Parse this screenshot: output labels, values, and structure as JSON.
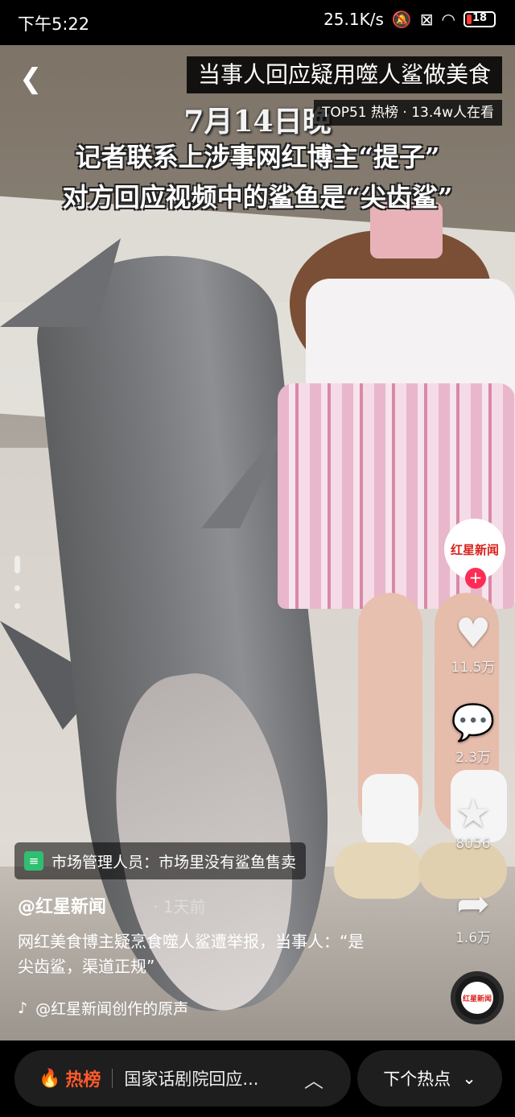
{
  "status_bar": {
    "time": "下午5:22",
    "net_speed": "25.1K/s",
    "battery": "18"
  },
  "header": {
    "back_icon": "chevron-left-icon",
    "title": "当事人回应疑用噬人鲨做美食",
    "hot_rank": "TOP51 热榜",
    "viewers": "13.4w人在看"
  },
  "video_captions": {
    "date": "7月14日晚",
    "line1": "记者联系上涉事网红博主“提子”",
    "line2": "对方回应视频中的鲨鱼是“尖齿鲨”"
  },
  "actions": {
    "avatar_text": "红星新闻",
    "follow_label": "+",
    "likes": "11.5万",
    "comments": "2.3万",
    "favorites": "8056",
    "shares": "1.6万"
  },
  "info": {
    "tag": "市场管理人员：市场里没有鲨鱼售卖",
    "author": "@红星新闻",
    "time_ago": "1天前",
    "description": "网红美食博主疑烹食噬人鲨遭举报，当事人：“是尖齿鲨，渠道正规”",
    "music": "@红星新闻创作的原声"
  },
  "bottom_bar": {
    "hot_label": "热榜",
    "hot_topic": "国家话剧院回应...",
    "next_label": "下个热点"
  },
  "colors": {
    "accent_red": "#fe2c55",
    "hot_orange": "#ff5a2a",
    "brand_red": "#d9221b"
  }
}
